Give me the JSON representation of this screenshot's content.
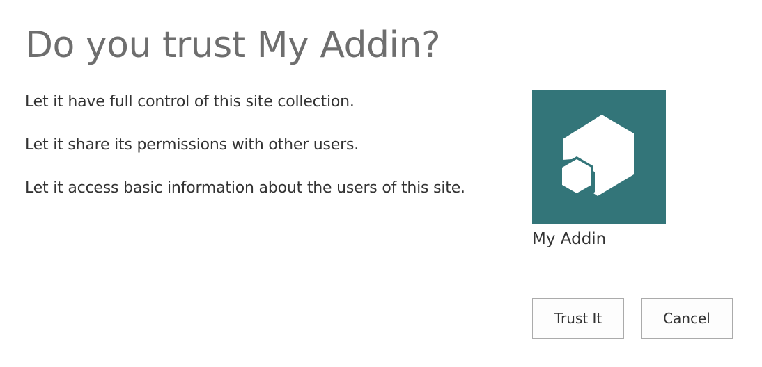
{
  "dialog": {
    "title": "Do you trust My Addin?",
    "permissions": [
      "Let it have full control of this site collection.",
      "Let it share its permissions with other users.",
      "Let it access basic information about the users of this site."
    ],
    "app": {
      "name": "My Addin",
      "icon": "addin-hexagon-icon",
      "tile_color": "#337579"
    },
    "buttons": {
      "trust_label": "Trust It",
      "cancel_label": "Cancel"
    }
  }
}
